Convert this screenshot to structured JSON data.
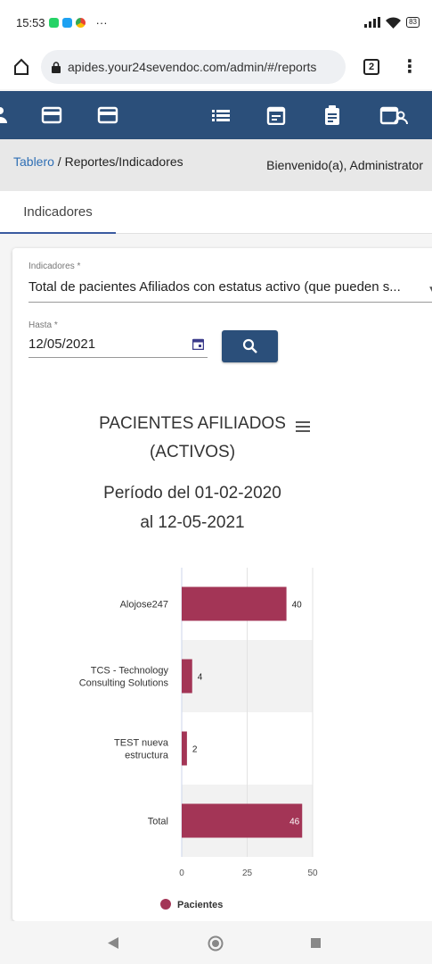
{
  "status_bar": {
    "time": "15:53",
    "dots": "···",
    "battery": "83"
  },
  "browser": {
    "url": "apides.your24sevendoc.com/admin/#/reports",
    "tab_count": "2"
  },
  "breadcrumb": {
    "link": "Tablero",
    "rest": " / Reportes/Indicadores"
  },
  "header": {
    "welcome": "Bienvenido(a), Administrator"
  },
  "tabs": {
    "active": "Indicadores"
  },
  "form": {
    "indicator_label": "Indicadores *",
    "indicator_value": "Total de pacientes Afiliados con estatus activo (que pueden s...",
    "date_label": "Hasta *",
    "date_value": "12/05/2021"
  },
  "chart_data": {
    "type": "bar",
    "orientation": "horizontal",
    "title": "PACIENTES AFILIADOS (ACTIVOS)",
    "title_lines": [
      "PACIENTES AFILIADOS",
      "(ACTIVOS)"
    ],
    "subtitle": "Período del 01-02-2020 al 12-05-2021",
    "subtitle_lines": [
      "Período del 01-02-2020",
      "al 12-05-2021"
    ],
    "categories": [
      "Alojose247",
      "TCS - Technology Consulting Solutions",
      "TEST nueva estructura",
      "Total"
    ],
    "category_lines": [
      [
        "Alojose247"
      ],
      [
        "TCS - Technology",
        "Consulting Solutions"
      ],
      [
        "TEST nueva",
        "estructura"
      ],
      [
        "Total"
      ]
    ],
    "series": [
      {
        "name": "Pacientes",
        "values": [
          40,
          4,
          2,
          46
        ],
        "color": "#a33556"
      }
    ],
    "xlim": [
      0,
      50
    ],
    "xticks": [
      0,
      25,
      50
    ],
    "legend": "bottom",
    "grid": true
  }
}
